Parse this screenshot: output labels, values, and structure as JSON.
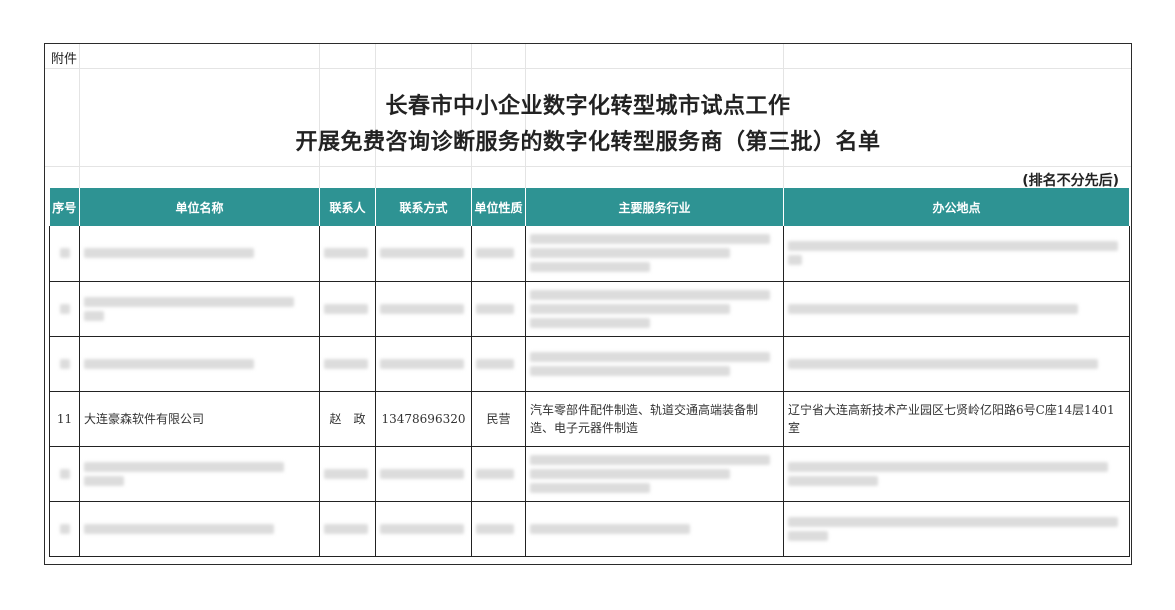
{
  "attachment_label": "附件",
  "title_line1": "长春市中小企业数字化转型城市试点工作",
  "title_line2": "开展免费咨询诊断服务的数字化转型服务商（第三批）名单",
  "order_note": "(排名不分先后)",
  "columns": [
    "序号",
    "单位名称",
    "联系人",
    "联系方式",
    "单位性质",
    "主要服务行业",
    "办公地点"
  ],
  "visible_row": {
    "index": "11",
    "company": "大连豪森软件有限公司",
    "contact": "赵　政",
    "phone": "13478696320",
    "type": "民营",
    "industry": "汽车零部件配件制造、轨道交通高端装备制造、电子元器件制造",
    "address": "辽宁省大连高新技术产业园区七贤岭亿阳路6号C座14层1401室"
  },
  "colors": {
    "header_bg": "#2e9393",
    "header_text": "#ffffff",
    "border": "#222222"
  }
}
